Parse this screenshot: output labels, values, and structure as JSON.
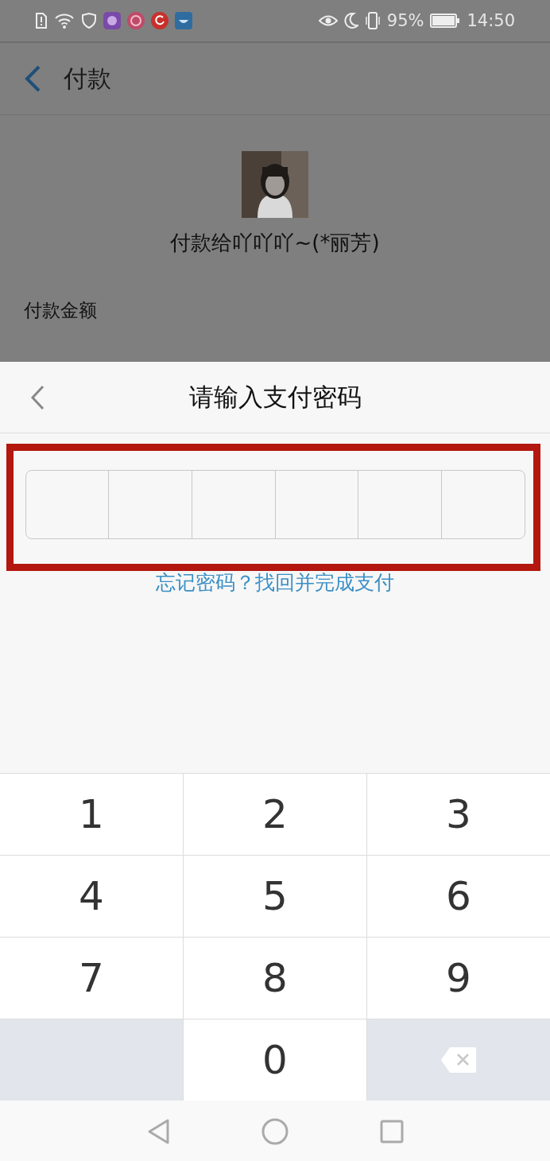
{
  "status_bar": {
    "battery": "95%",
    "time": "14:50"
  },
  "header": {
    "title": "付款"
  },
  "payee": {
    "name": "付款给吖吖吖~(*丽芳)"
  },
  "amount_label": "付款金额",
  "password_sheet": {
    "title": "请输入支付密码",
    "forgot_link": "忘记密码？找回并完成支付"
  },
  "keypad": [
    {
      "kind": "digit",
      "label": "1"
    },
    {
      "kind": "digit",
      "label": "2"
    },
    {
      "kind": "digit",
      "label": "3"
    },
    {
      "kind": "digit",
      "label": "4"
    },
    {
      "kind": "digit",
      "label": "5"
    },
    {
      "kind": "digit",
      "label": "6"
    },
    {
      "kind": "digit",
      "label": "7"
    },
    {
      "kind": "digit",
      "label": "8"
    },
    {
      "kind": "digit",
      "label": "9"
    },
    {
      "kind": "blank"
    },
    {
      "kind": "digit",
      "label": "0"
    },
    {
      "kind": "backspace"
    }
  ]
}
